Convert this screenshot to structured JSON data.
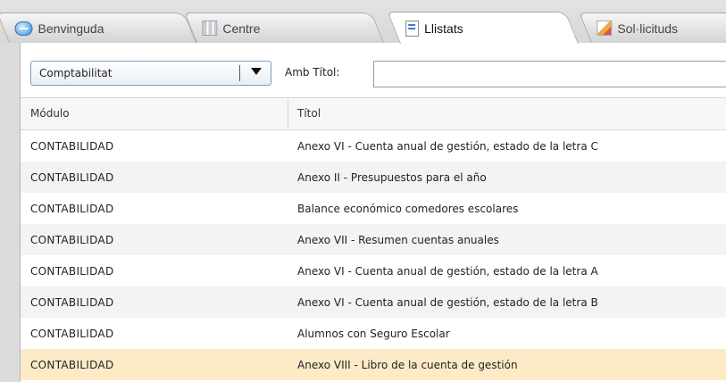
{
  "tabs": [
    {
      "label": "Benvinguda",
      "icon": "chat-icon"
    },
    {
      "label": "Centre",
      "icon": "grid-icon"
    },
    {
      "label": "Llistats",
      "icon": "list-icon",
      "active": true
    },
    {
      "label": "Sol·licituds",
      "icon": "pencil-icon"
    }
  ],
  "filter": {
    "select_value": "Comptabilitat",
    "title_label": "Amb Títol:",
    "title_value": ""
  },
  "table": {
    "columns": [
      "Módulo",
      "Títol"
    ],
    "rows": [
      {
        "modulo": "CONTABILIDAD",
        "titol": "Anexo VI - Cuenta anual de gestión, estado de la letra C"
      },
      {
        "modulo": "CONTABILIDAD",
        "titol": "Anexo II - Presupuestos para el año"
      },
      {
        "modulo": "CONTABILIDAD",
        "titol": "Balance económico comedores escolares"
      },
      {
        "modulo": "CONTABILIDAD",
        "titol": "Anexo VII - Resumen cuentas anuales"
      },
      {
        "modulo": "CONTABILIDAD",
        "titol": "Anexo VI - Cuenta anual de gestión, estado de la letra A"
      },
      {
        "modulo": "CONTABILIDAD",
        "titol": "Anexo VI - Cuenta anual de gestión, estado de la letra B"
      },
      {
        "modulo": "CONTABILIDAD",
        "titol": "Alumnos con Seguro Escolar"
      },
      {
        "modulo": "CONTABILIDAD",
        "titol": "Anexo VIII - Libro de la cuenta de gestión"
      }
    ],
    "selected_index": 7
  },
  "colors": {
    "selected_row": "#fdebc8",
    "alt_row": "#f3f3f3"
  }
}
